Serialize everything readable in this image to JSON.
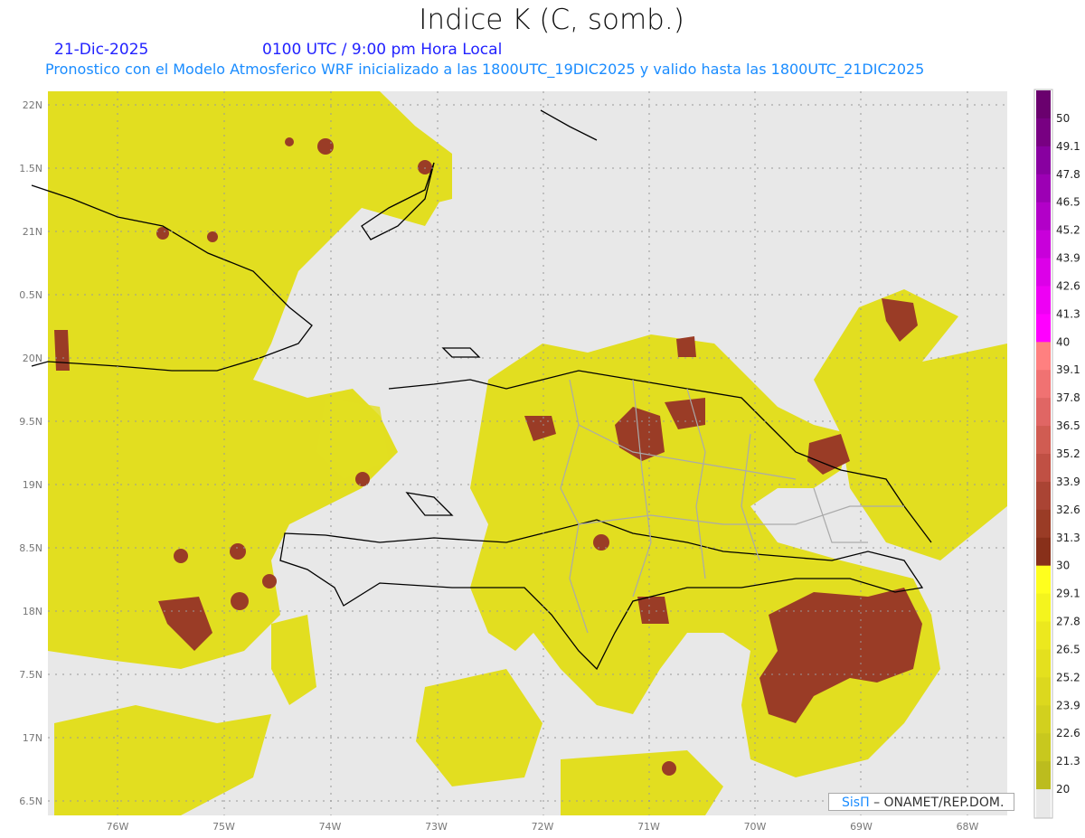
{
  "title": "Indice K (C, somb.)",
  "date": "21-Dic-2025",
  "time": "0100 UTC / 9:00 pm Hora Local",
  "subtitle": "Pronostico con el Modelo Atmosferico WRF inicializado a las 1800UTC_19DIC2025 y valido hasta las  1800UTC_21DIC2025",
  "credit": {
    "logo": "SisΠ",
    "text": "– ONAMET/REP.DOM."
  },
  "lon_labels": [
    "76W",
    "75W",
    "74W",
    "73W",
    "72W",
    "71W",
    "70W",
    "69W",
    "68W"
  ],
  "lat_labels": [
    "22N",
    "1.5N",
    "21N",
    "0.5N",
    "20N",
    "9.5N",
    "19N",
    "8.5N",
    "18N",
    "7.5N",
    "17N",
    "6.5N"
  ],
  "colorbar": {
    "labels": [
      "50",
      "49.1",
      "47.8",
      "46.5",
      "45.2",
      "43.9",
      "42.6",
      "41.3",
      "40",
      "39.1",
      "37.8",
      "36.5",
      "35.2",
      "33.9",
      "32.6",
      "31.3",
      "30",
      "29.1",
      "27.8",
      "26.5",
      "25.2",
      "23.9",
      "22.6",
      "21.3",
      "20"
    ],
    "colors": [
      "#6a006e",
      "#780082",
      "#8800a0",
      "#9c00b4",
      "#b200c8",
      "#c800da",
      "#dc00e8",
      "#ee00f4",
      "#ff00ff",
      "#ff8080",
      "#f07272",
      "#e06664",
      "#d05c52",
      "#c05044",
      "#aa4434",
      "#9a3c26",
      "#88301a",
      "#ffff1e",
      "#f4f41e",
      "#ece81e",
      "#e4e01e",
      "#dcd81e",
      "#d2d01e",
      "#c8c81e",
      "#bcbc1e",
      "#e8e8e8"
    ]
  },
  "fill_colors": {
    "background": "#e8e8e8",
    "k_20_30": "#e2de20",
    "k_30_plus": "#9a3c26",
    "coast": "#000000",
    "provinces": "#aaaaaa"
  }
}
